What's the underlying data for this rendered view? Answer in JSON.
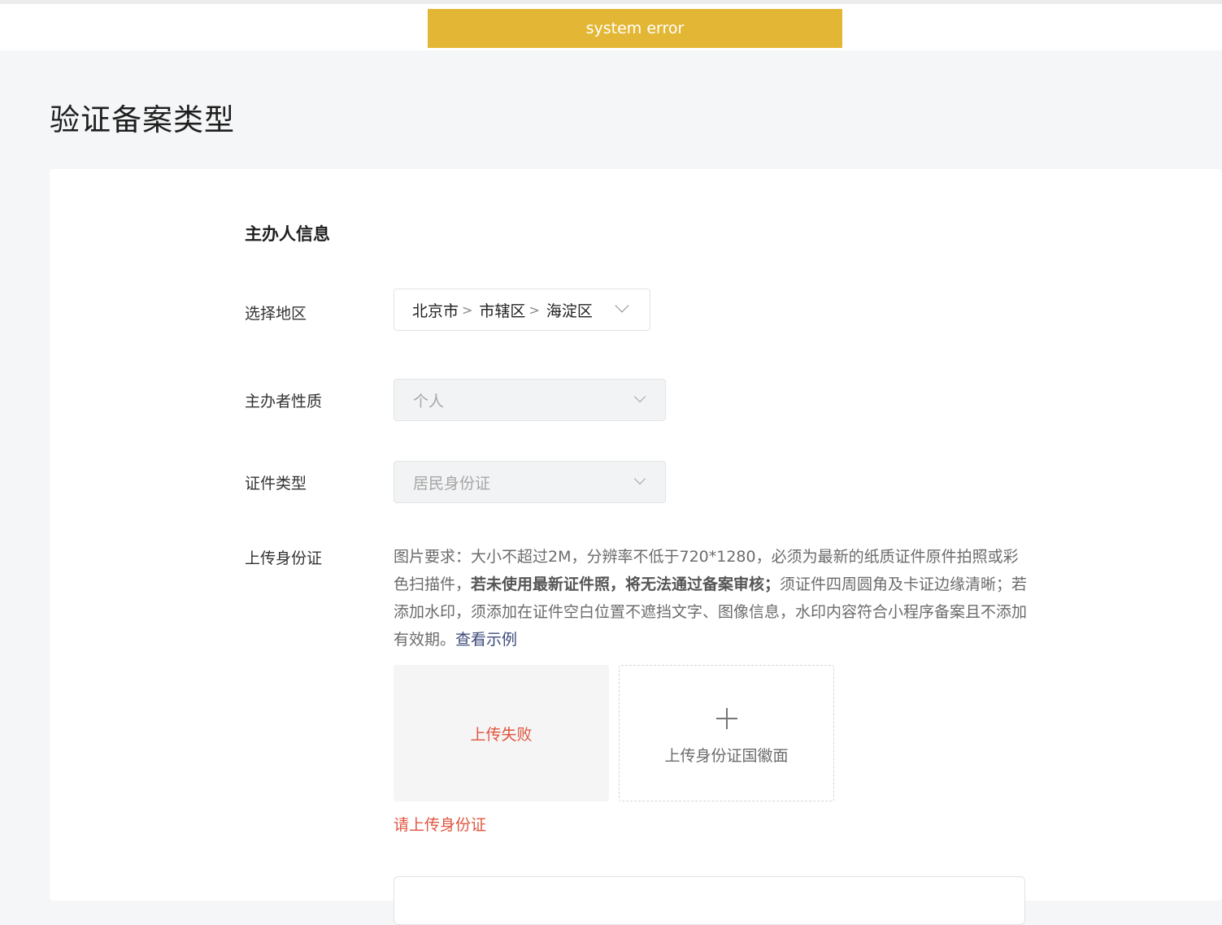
{
  "banner": {
    "message": "system error"
  },
  "page": {
    "title": "验证备案类型"
  },
  "section": {
    "title": "主办人信息"
  },
  "form": {
    "region": {
      "label": "选择地区",
      "parts": [
        "北京市",
        "市辖区",
        "海淀区"
      ]
    },
    "sponsor_type": {
      "label": "主办者性质",
      "value": "个人"
    },
    "id_type": {
      "label": "证件类型",
      "value": "居民身份证"
    },
    "id_upload": {
      "label": "上传身份证",
      "requirement_pre": "图片要求：大小不超过2M，分辨率不低于720*1280，必须为最新的纸质证件原件拍照或彩色扫描件，",
      "requirement_bold": "若未使用最新证件照，将无法通过备案审核；",
      "requirement_post": "须证件四周圆角及卡证边缘清晰；若添加水印，须添加在证件空白位置不遮挡文字、图像信息，水印内容符合小程序备案且不添加有效期。",
      "example_link": "查看示例",
      "failed_text": "上传失败",
      "back_side_label": "上传身份证国徽面",
      "error": "请上传身份证"
    }
  }
}
